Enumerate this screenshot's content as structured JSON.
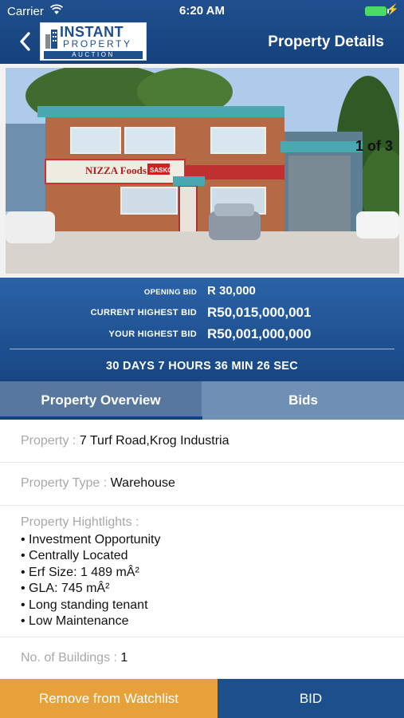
{
  "status": {
    "carrier": "Carrier",
    "time": "6:20 AM",
    "icons": [
      "wifi-icon",
      "battery-icon",
      "charging-bolt-icon"
    ]
  },
  "header": {
    "logo": {
      "line1": "INSTANT",
      "line2": "PROPERTY",
      "line3": "AUCTION"
    },
    "title": "Property Details",
    "back_icon": "chevron-left-icon"
  },
  "gallery": {
    "counter": "1 of 3",
    "sign_text": "NIZZA Foods",
    "sign_sub": "SASKO"
  },
  "bids": {
    "opening_label": "OPENING BID",
    "opening_value": "R 30,000",
    "current_label": "CURRENT HIGHEST BID",
    "current_value": "R50,015,000,001",
    "your_label": "YOUR HIGHEST BID",
    "your_value": "R50,001,000,000",
    "timer": "30 DAYS  7 HOURS  36 MIN  26 SEC"
  },
  "tabs": {
    "overview": "Property Overview",
    "bids": "Bids"
  },
  "details": {
    "property_key": "Property :",
    "property_val": "7 Turf Road,Krog Industria",
    "type_key": "Property Type :",
    "type_val": "Warehouse",
    "highlights_key": "Property Hightlights :",
    "highlights": [
      "Investment Opportunity",
      "Centrally Located",
      "Erf Size: 1 489 mÂ²",
      "GLA: 745 mÂ²",
      "Long standing tenant",
      "Low Maintenance"
    ],
    "buildings_key": "No. of Buildings :",
    "buildings_val": "1"
  },
  "actions": {
    "watchlist": "Remove from Watchlist",
    "bid": "BID"
  },
  "colors": {
    "header_blue": "#1d4f8d",
    "watchlist_orange": "#e7a13a",
    "tab_active": "#57779e"
  }
}
